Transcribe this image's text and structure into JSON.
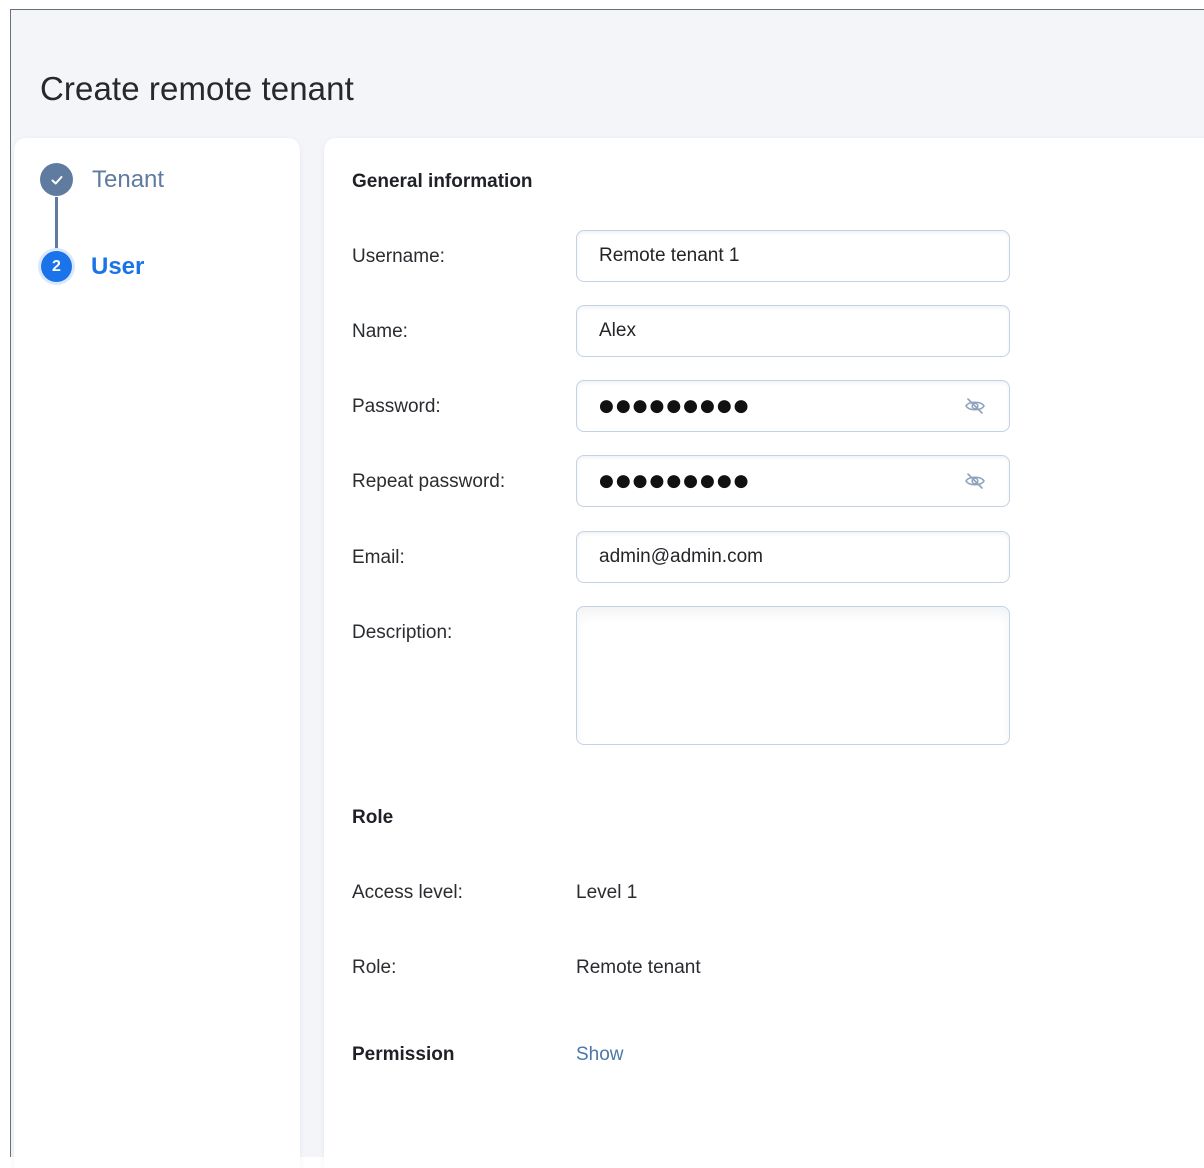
{
  "page": {
    "title": "Create remote tenant"
  },
  "stepper": {
    "steps": [
      {
        "label": "Tenant",
        "state": "completed",
        "marker_icon": "check-icon"
      },
      {
        "label": "User",
        "state": "active",
        "marker": "2"
      }
    ]
  },
  "general": {
    "section_title": "General information",
    "username": {
      "label": "Username:",
      "value": "Remote tenant 1"
    },
    "name": {
      "label": "Name:",
      "value": "Alex"
    },
    "password": {
      "label": "Password:",
      "value": "●●●●●●●●●",
      "toggle_icon": "eye-slash-icon"
    },
    "repeat_password": {
      "label": "Repeat password:",
      "value": "●●●●●●●●●",
      "toggle_icon": "eye-slash-icon"
    },
    "email": {
      "label": "Email:",
      "value": "admin@admin.com"
    },
    "description": {
      "label": "Description:",
      "value": ""
    }
  },
  "role": {
    "section_title": "Role",
    "access_level": {
      "label": "Access level:",
      "value": "Level 1"
    },
    "role": {
      "label": "Role:",
      "value": "Remote tenant"
    }
  },
  "permission": {
    "label": "Permission",
    "link": "Show"
  },
  "colors": {
    "accent": "#1a73e8",
    "step_done": "#5f7ca0",
    "link": "#4a78a8",
    "background": "#f3f5f9"
  }
}
